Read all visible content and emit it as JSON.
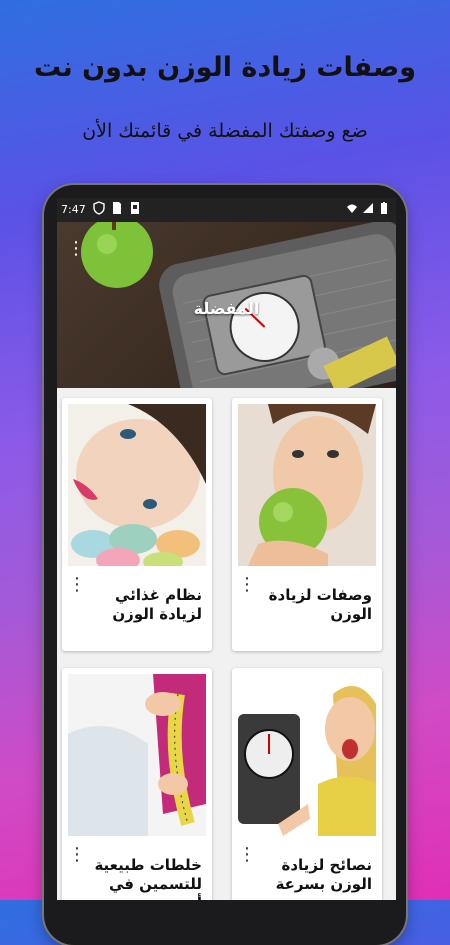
{
  "promo": {
    "headline": "وصفات زيادة الوزن بدون نت",
    "subline": "ضع وصفتك المفضلة في قائمتك الأن"
  },
  "statusbar": {
    "time": "7:47",
    "icons": [
      "shield-icon",
      "sim-icon",
      "sd-card-icon",
      "wifi-icon",
      "signal-icon",
      "battery-icon"
    ]
  },
  "app": {
    "header_title": "المفضلة",
    "menu_icon": "more-vert-icon"
  },
  "cards": [
    {
      "title": "وصفات لزيادة الوزن",
      "image": "woman-eating-apple"
    },
    {
      "title": "نظام غذائي لزيادة الوزن",
      "image": "woman-with-macarons"
    },
    {
      "title": "نصائح لزيادة الوزن بسرعة",
      "image": "woman-with-scale"
    },
    {
      "title": "خلطات طبيعية للتسمين في أسبوع",
      "image": "tape-measure"
    }
  ],
  "colors": {
    "card_bg": "#ffffff",
    "screen_bg": "#f1f1f1",
    "statusbar_bg": "#222222"
  }
}
